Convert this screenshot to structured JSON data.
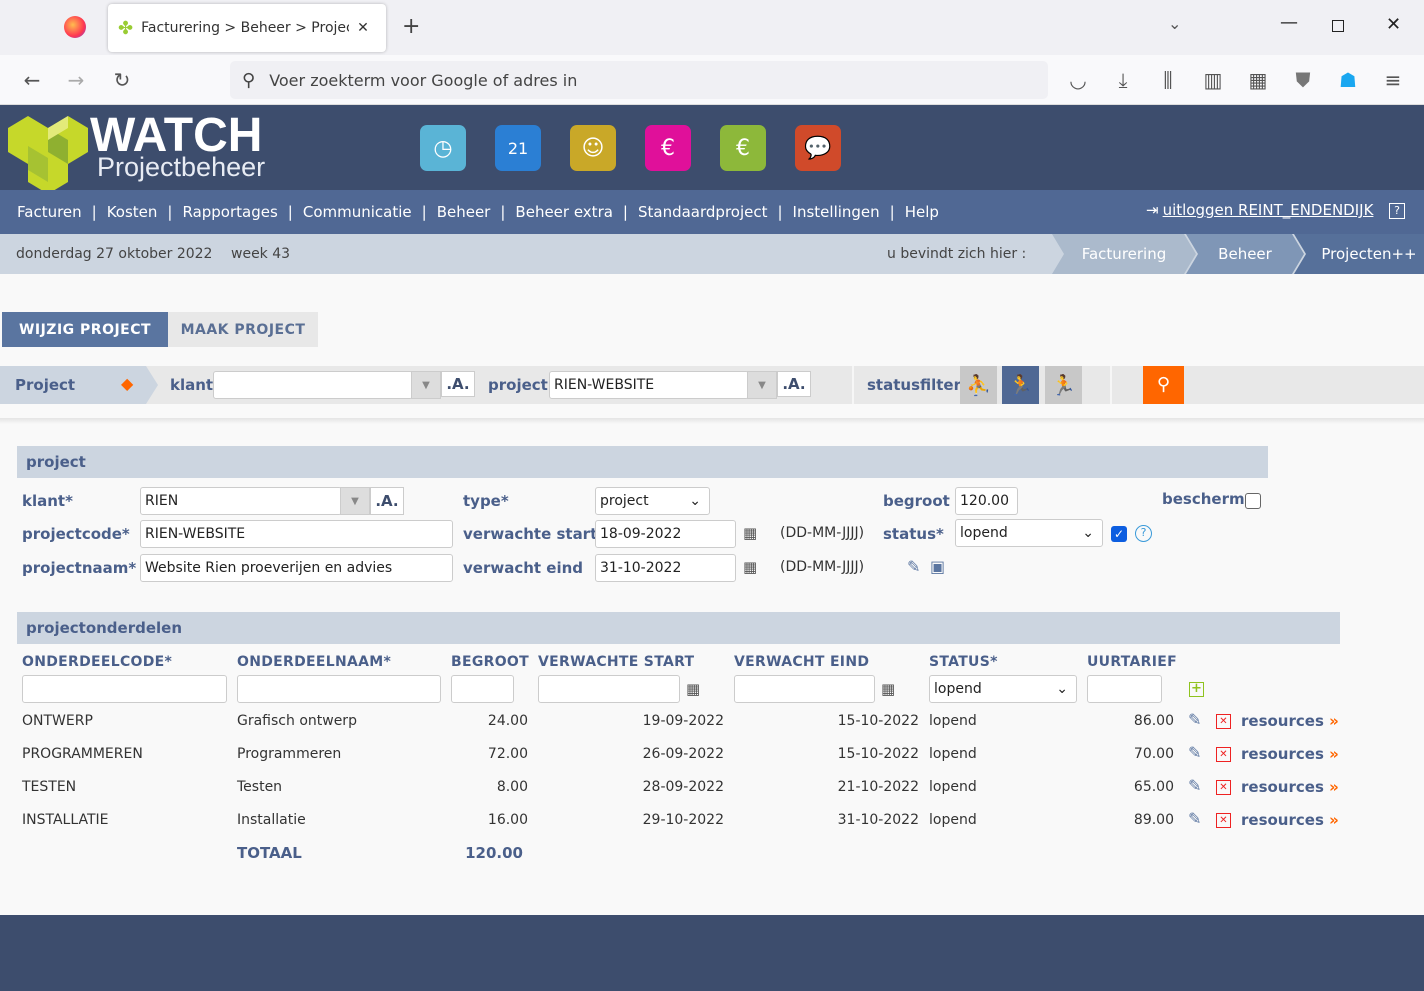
{
  "browser": {
    "tab_title": "Facturering > Beheer > Projecten++",
    "url_placeholder": "Voer zoekterm voor Google of adres in"
  },
  "app": {
    "logo_title": "WATCH",
    "logo_subtitle": "Projectbeheer",
    "app_icons": [
      {
        "name": "clock-icon",
        "color": "#5ab4d6"
      },
      {
        "name": "calendar-icon",
        "color": "#2b7fd4"
      },
      {
        "name": "people-icon",
        "color": "#c9a828"
      },
      {
        "name": "invoice-icon",
        "color": "#e0109a"
      },
      {
        "name": "calculator-icon",
        "color": "#8db83a"
      },
      {
        "name": "chat-icon",
        "color": "#d04a2a"
      }
    ]
  },
  "menu": {
    "items": [
      "Facturen",
      "Kosten",
      "Rapportages",
      "Communicatie",
      "Beheer",
      "Beheer extra",
      "Standaardproject",
      "Instellingen",
      "Help"
    ],
    "logout": "uitloggen REINT_ENDENDIJK"
  },
  "infobar": {
    "date": "donderdag 27 oktober 2022",
    "week": "week 43",
    "location_label": "u bevindt zich hier :",
    "breadcrumbs": [
      "Facturering",
      "Beheer",
      "Projecten++"
    ]
  },
  "tabs": [
    "WIJZIG PROJECT",
    "MAAK PROJECT"
  ],
  "filter": {
    "section": "Project",
    "klant_label": "klant",
    "klant_value": "",
    "a_label": ".A.",
    "project_label": "project",
    "project_value": "RIEN-WEBSITE",
    "statusfilter_label": "statusfilter",
    "active_status": 1
  },
  "project": {
    "title": "project",
    "klant_label": "klant*",
    "klant": "RIEN",
    "projectcode_label": "projectcode*",
    "projectcode": "RIEN-WEBSITE",
    "projectnaam_label": "projectnaam*",
    "projectnaam": "Website Rien proeverijen en advies",
    "type_label": "type*",
    "type": "project",
    "start_label": "verwachte start",
    "start": "18-09-2022",
    "eind_label": "verwacht eind",
    "eind": "31-10-2022",
    "date_format": "(DD-MM-JJJJ)",
    "begroot_label": "begroot",
    "begroot": "120.00",
    "status_label": "status*",
    "status": "lopend",
    "bescherm_label": "bescherm",
    "bescherm": false,
    "status_checked": true
  },
  "onderdelen": {
    "title": "projectonderdelen",
    "headers": [
      "ONDERDEELCODE*",
      "ONDERDEELNAAM*",
      "BEGROOT",
      "VERWACHTE START",
      "VERWACHT EIND",
      "STATUS*",
      "UURTARIEF"
    ],
    "new_status": "lopend",
    "rows": [
      {
        "code": "ONTWERP",
        "naam": "Grafisch ontwerp",
        "begroot": "24.00",
        "start": "19-09-2022",
        "eind": "15-10-2022",
        "status": "lopend",
        "tarief": "86.00"
      },
      {
        "code": "PROGRAMMEREN",
        "naam": "Programmeren",
        "begroot": "72.00",
        "start": "26-09-2022",
        "eind": "15-10-2022",
        "status": "lopend",
        "tarief": "70.00"
      },
      {
        "code": "TESTEN",
        "naam": "Testen",
        "begroot": "8.00",
        "start": "28-09-2022",
        "eind": "21-10-2022",
        "status": "lopend",
        "tarief": "65.00"
      },
      {
        "code": "INSTALLATIE",
        "naam": "Installatie",
        "begroot": "16.00",
        "start": "29-10-2022",
        "eind": "31-10-2022",
        "status": "lopend",
        "tarief": "89.00"
      }
    ],
    "resources_label": "resources",
    "total_label": "TOTAAL",
    "total": "120.00"
  }
}
